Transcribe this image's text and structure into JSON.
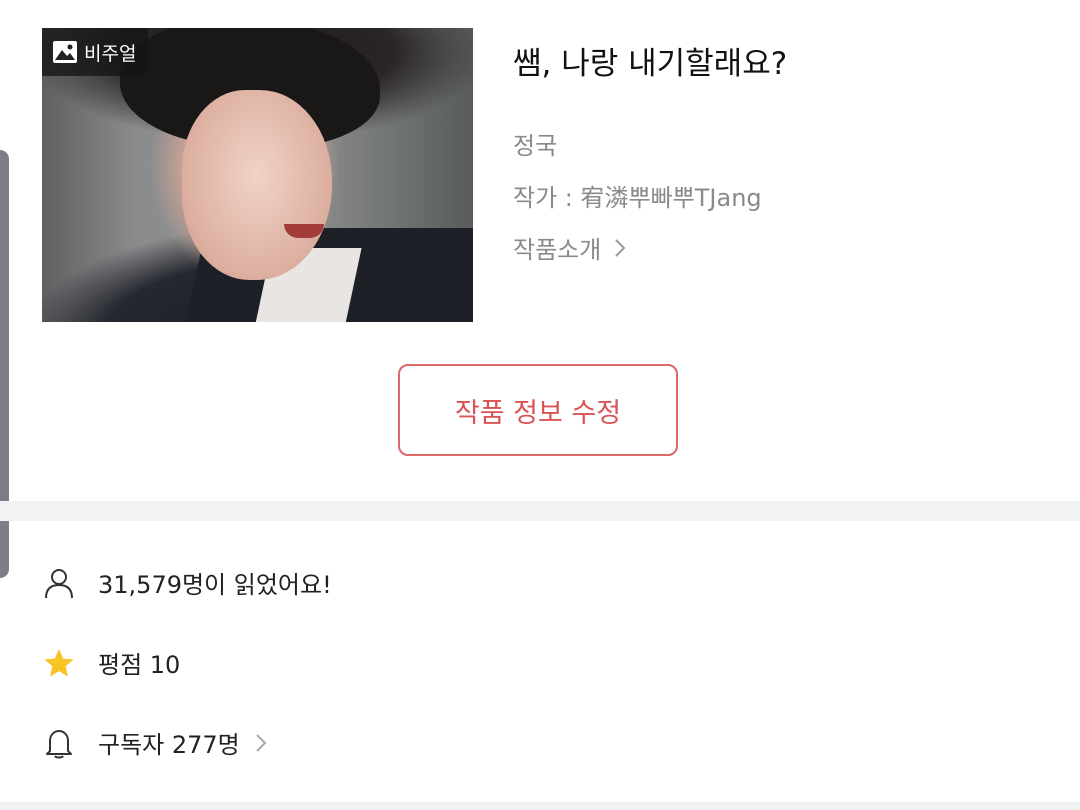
{
  "work": {
    "badge_label": "비주얼",
    "title": "쌤, 나랑 내기할래요?",
    "character": "정국",
    "author_line": "작가 : 宥潾뿌빠뿌TJang",
    "intro_label": "작품소개"
  },
  "actions": {
    "edit_label": "작품 정보 수정"
  },
  "stats": {
    "readers_text": "31,579명이 읽었어요!",
    "rating_text": "평점 10",
    "subscribers_text": "구독자 277명"
  },
  "colors": {
    "accent": "#dc6868",
    "star": "#f7c325",
    "muted_text": "#8a8a8a",
    "divider": "#f1f2f4"
  },
  "icons": {
    "badge": "image-icon",
    "intro": "chevron-right-icon",
    "readers": "person-icon",
    "rating": "star-icon",
    "subscribers": "bell-icon"
  }
}
